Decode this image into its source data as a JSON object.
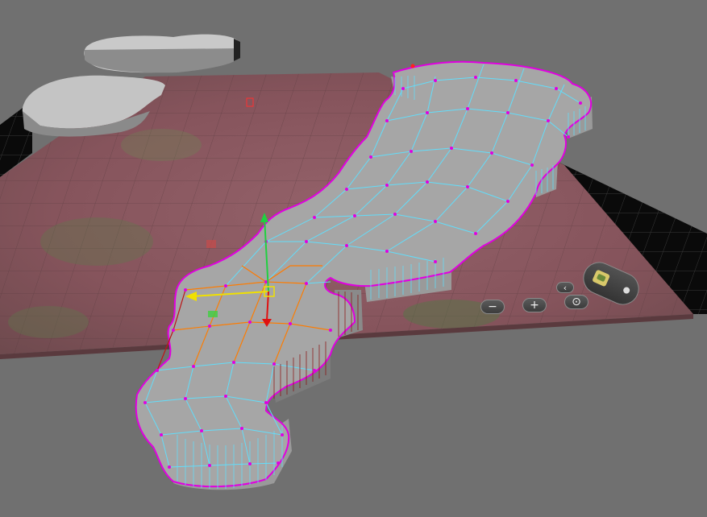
{
  "viewport": {
    "background_color": "#707070",
    "terrain_color": "#8a5a62",
    "mesh_fill_color": "#a6a6a6",
    "edge_color": "#5fe0ff",
    "vertex_color": "#e000e0",
    "selected_edge_color": "#ff7a00",
    "gizmo": {
      "x_axis_color": "#e01010",
      "y_axis_color": "#20d040",
      "z_axis_color": "#f0e000"
    }
  },
  "nav_controls": {
    "zoom_out_label": "−",
    "zoom_in_label": "+",
    "reset_label": "⊙",
    "rotate_label": "‹"
  }
}
